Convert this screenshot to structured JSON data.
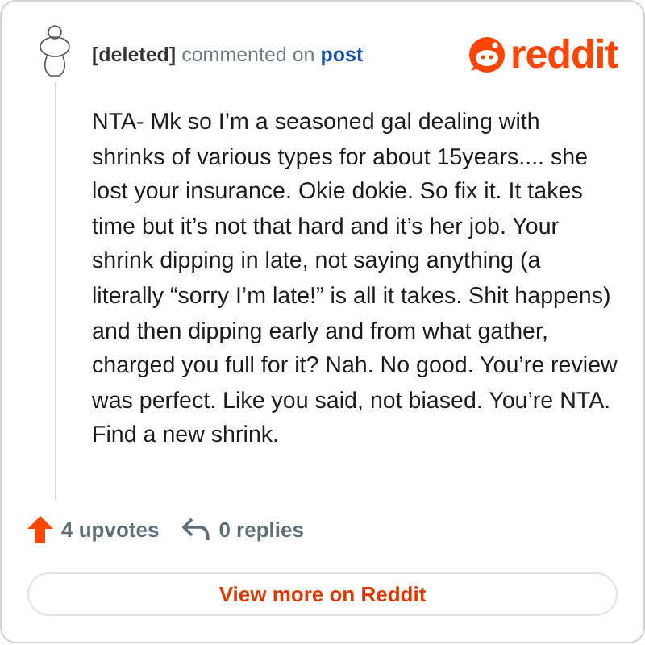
{
  "header": {
    "author": "[deleted]",
    "action": "commented on",
    "target": "post",
    "brand": "reddit"
  },
  "comment": {
    "body": "NTA- Mk so I’m a seasoned gal dealing with shrinks of various types for about 15years.... she lost your insurance. Okie dokie. So fix it. It takes time but it’s not that hard and it’s her job. Your shrink dipping in late, not saying anything (a literally “sorry I’m late!” is all it takes. Shit happens) and then dipping early and from what gather, charged you full for it? Nah. No good. You’re review was perfect. Like you said, not biased. You’re NTA. Find a new shrink."
  },
  "footer": {
    "upvotes": "4 upvotes",
    "replies": "0 replies",
    "button": "View more on Reddit"
  }
}
